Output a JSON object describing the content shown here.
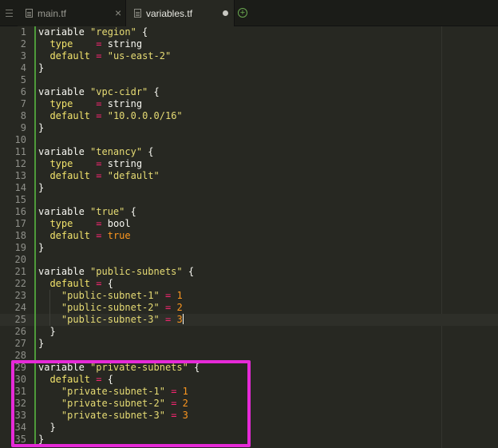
{
  "tabs": [
    {
      "label": "main.tf",
      "active": false
    },
    {
      "label": "variables.tf",
      "active": true,
      "modified": true
    }
  ],
  "icons": {
    "menu": "menu-icon",
    "file": "file-icon",
    "close": "close-icon",
    "modified": "dirty-dot-icon",
    "new_tab": "new-tab-icon"
  },
  "code": {
    "lines": [
      {
        "n": "1",
        "t": [
          [
            "kw",
            "variable "
          ],
          [
            "str",
            "\"region\""
          ],
          [
            "kw",
            " {"
          ]
        ]
      },
      {
        "n": "2",
        "t": [
          [
            "kw",
            "  "
          ],
          [
            "attr",
            "type"
          ],
          [
            "kw",
            "    "
          ],
          [
            "op",
            "="
          ],
          [
            "kw",
            " string"
          ]
        ]
      },
      {
        "n": "3",
        "t": [
          [
            "kw",
            "  "
          ],
          [
            "attr",
            "default"
          ],
          [
            "kw",
            " "
          ],
          [
            "op",
            "="
          ],
          [
            "kw",
            " "
          ],
          [
            "str",
            "\"us-east-2\""
          ]
        ]
      },
      {
        "n": "4",
        "t": [
          [
            "kw",
            "}"
          ]
        ]
      },
      {
        "n": "5",
        "t": []
      },
      {
        "n": "6",
        "t": [
          [
            "kw",
            "variable "
          ],
          [
            "str",
            "\"vpc-cidr\""
          ],
          [
            "kw",
            " {"
          ]
        ]
      },
      {
        "n": "7",
        "t": [
          [
            "kw",
            "  "
          ],
          [
            "attr",
            "type"
          ],
          [
            "kw",
            "    "
          ],
          [
            "op",
            "="
          ],
          [
            "kw",
            " string"
          ]
        ]
      },
      {
        "n": "8",
        "t": [
          [
            "kw",
            "  "
          ],
          [
            "attr",
            "default"
          ],
          [
            "kw",
            " "
          ],
          [
            "op",
            "="
          ],
          [
            "kw",
            " "
          ],
          [
            "str",
            "\"10.0.0.0/16\""
          ]
        ]
      },
      {
        "n": "9",
        "t": [
          [
            "kw",
            "}"
          ]
        ]
      },
      {
        "n": "10",
        "t": []
      },
      {
        "n": "11",
        "t": [
          [
            "kw",
            "variable "
          ],
          [
            "str",
            "\"tenancy\""
          ],
          [
            "kw",
            " {"
          ]
        ]
      },
      {
        "n": "12",
        "t": [
          [
            "kw",
            "  "
          ],
          [
            "attr",
            "type"
          ],
          [
            "kw",
            "    "
          ],
          [
            "op",
            "="
          ],
          [
            "kw",
            " string"
          ]
        ]
      },
      {
        "n": "13",
        "t": [
          [
            "kw",
            "  "
          ],
          [
            "attr",
            "default"
          ],
          [
            "kw",
            " "
          ],
          [
            "op",
            "="
          ],
          [
            "kw",
            " "
          ],
          [
            "str",
            "\"default\""
          ]
        ]
      },
      {
        "n": "14",
        "t": [
          [
            "kw",
            "}"
          ]
        ]
      },
      {
        "n": "15",
        "t": []
      },
      {
        "n": "16",
        "t": [
          [
            "kw",
            "variable "
          ],
          [
            "str",
            "\"true\""
          ],
          [
            "kw",
            " {"
          ]
        ]
      },
      {
        "n": "17",
        "t": [
          [
            "kw",
            "  "
          ],
          [
            "attr",
            "type"
          ],
          [
            "kw",
            "    "
          ],
          [
            "op",
            "="
          ],
          [
            "kw",
            " bool"
          ]
        ]
      },
      {
        "n": "18",
        "t": [
          [
            "kw",
            "  "
          ],
          [
            "attr",
            "default"
          ],
          [
            "kw",
            " "
          ],
          [
            "op",
            "="
          ],
          [
            "kw",
            " "
          ],
          [
            "bool",
            "true"
          ]
        ]
      },
      {
        "n": "19",
        "t": [
          [
            "kw",
            "}"
          ]
        ]
      },
      {
        "n": "20",
        "t": []
      },
      {
        "n": "21",
        "t": [
          [
            "kw",
            "variable "
          ],
          [
            "str",
            "\"public-subnets\""
          ],
          [
            "kw",
            " {"
          ]
        ]
      },
      {
        "n": "22",
        "t": [
          [
            "kw",
            "  "
          ],
          [
            "attr",
            "default"
          ],
          [
            "kw",
            " "
          ],
          [
            "op",
            "="
          ],
          [
            "kw",
            " {"
          ]
        ]
      },
      {
        "n": "23",
        "t": [
          [
            "kw",
            "    "
          ],
          [
            "str",
            "\"public-subnet-1\""
          ],
          [
            "kw",
            " "
          ],
          [
            "op",
            "="
          ],
          [
            "kw",
            " "
          ],
          [
            "num",
            "1"
          ]
        ]
      },
      {
        "n": "24",
        "t": [
          [
            "kw",
            "    "
          ],
          [
            "str",
            "\"public-subnet-2\""
          ],
          [
            "kw",
            " "
          ],
          [
            "op",
            "="
          ],
          [
            "kw",
            " "
          ],
          [
            "num",
            "2"
          ]
        ]
      },
      {
        "n": "25",
        "t": [
          [
            "kw",
            "    "
          ],
          [
            "str",
            "\"public-subnet-3\""
          ],
          [
            "kw",
            " "
          ],
          [
            "op",
            "="
          ],
          [
            "kw",
            " "
          ],
          [
            "num",
            "3"
          ]
        ],
        "current": true
      },
      {
        "n": "26",
        "t": [
          [
            "kw",
            "  }"
          ]
        ]
      },
      {
        "n": "27",
        "t": [
          [
            "kw",
            "}"
          ]
        ]
      },
      {
        "n": "28",
        "t": []
      },
      {
        "n": "29",
        "t": [
          [
            "kw",
            "variable "
          ],
          [
            "str",
            "\"private-subnets\""
          ],
          [
            "kw",
            " {"
          ]
        ]
      },
      {
        "n": "30",
        "t": [
          [
            "kw",
            "  "
          ],
          [
            "attr",
            "default"
          ],
          [
            "kw",
            " "
          ],
          [
            "op",
            "="
          ],
          [
            "kw",
            " {"
          ]
        ]
      },
      {
        "n": "31",
        "t": [
          [
            "kw",
            "    "
          ],
          [
            "str",
            "\"private-subnet-1\""
          ],
          [
            "kw",
            " "
          ],
          [
            "op",
            "="
          ],
          [
            "kw",
            " "
          ],
          [
            "num",
            "1"
          ]
        ]
      },
      {
        "n": "32",
        "t": [
          [
            "kw",
            "    "
          ],
          [
            "str",
            "\"private-subnet-2\""
          ],
          [
            "kw",
            " "
          ],
          [
            "op",
            "="
          ],
          [
            "kw",
            " "
          ],
          [
            "num",
            "2"
          ]
        ]
      },
      {
        "n": "33",
        "t": [
          [
            "kw",
            "    "
          ],
          [
            "str",
            "\"private-subnet-3\""
          ],
          [
            "kw",
            " "
          ],
          [
            "op",
            "="
          ],
          [
            "kw",
            " "
          ],
          [
            "num",
            "3"
          ]
        ]
      },
      {
        "n": "34",
        "t": [
          [
            "kw",
            "  }"
          ]
        ]
      },
      {
        "n": "35",
        "t": [
          [
            "kw",
            "}"
          ]
        ]
      }
    ]
  },
  "colors": {
    "background": "#272822",
    "string": "#e6db74",
    "operator": "#f92672",
    "number": "#fd971f",
    "added_marker": "#4e9a3a",
    "highlight_box": "#e62ad8"
  }
}
